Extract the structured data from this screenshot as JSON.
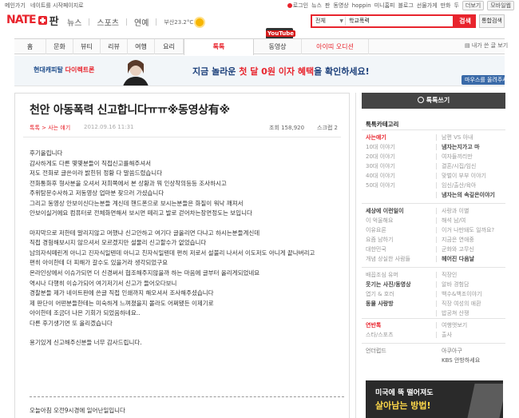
{
  "top_strip": {
    "left_links": [
      "메인가기",
      "네이트를 시작페이지로"
    ],
    "login_label": "로그인",
    "right_links": [
      "뉴스",
      "판",
      "동영상",
      "hoppin",
      "미니홈피",
      "블로그",
      "선물가게",
      "만화",
      "두",
      "더보기"
    ],
    "mobile_label": "모바일웹"
  },
  "header": {
    "logo_text": "NATE",
    "logo_sub": "판",
    "nav": [
      "뉴스",
      "스포츠",
      "연예"
    ],
    "weather": "부산23.2°C",
    "search_scope": "전체",
    "search_query": "학교폭력",
    "search_button": "검색",
    "all_search_button": "통합검색"
  },
  "menu": {
    "items": [
      "홈",
      "문화",
      "뷰티",
      "리뷰",
      "여행",
      "요리",
      "톡톡",
      "동영상",
      "아이띠 오디션"
    ],
    "active_index": 6,
    "youtube_badge": "YouTube",
    "right_link": "내가 쓴 글 보기"
  },
  "banner": {
    "brand": "현대캐피탈",
    "brand_sub": "다이렉트론",
    "text_pre": "지금 놀라운 ",
    "text_hl": "첫 달 0원 이자 혜택",
    "text_post": "을 확인하세요!",
    "more_label": "마우스를 올려주세요"
  },
  "article": {
    "title": "천안 아동폭력 신고합니다ㅠㅠ※동영상有※",
    "category": "톡톡 > 사는 얘기",
    "date": "2012.09.16 11:31",
    "views": "조회 158,920",
    "scrap": "스크랩 2",
    "paragraphs": [
      [
        "후기올립니다",
        "감사하게도 다른 몇몇분들이 직접신고를해주셔서",
        "저도 전화로 글쓴이라 밝힌뒤 정황 다 말씀드렸습니다",
        "전화통화후 형사분을 오셔서 저희쪽에서 본 상황과 뭐 인상착의등등 조사하시고",
        "주위탐문수사하고 저동영상 업마분 찾으러 가셨습니다",
        "그리고 동영상 안보이신다는분들 계신데 핸드폰으로 보시는분들은 화질이 워낙 깨져서",
        "안보이실거에요 컴퓨터로 전체화면해서 보시면 떼리고 발로 걷어차는장면정도는 보입니다"
      ],
      [
        "마지막으로 저한테 말리지않고 머했냐 신고안하고 여기다 글올리면 다냐고 하시는분들계신데",
        "직접 경험해보시지 않으셔서 모르겠지만 설물리 신고할수가 없었습니다",
        "남의자식떼린게 아니고 진자식일텐데 아니고 친자식일텐데 편히 저로서 설불리 나서서 이도저도 아니게 끝나버리고",
        "편히 아이한테 더 피해가 갈수도 있을거라 생각되었구요",
        "온라인상에서 이슈가되면 더 신경써서 협조해주지않을까 하는 마음에 글부터 올리게되었네요",
        "역시나 다행히 이슈가되어 여기저기서 신고가 들어오다보니",
        "경찰분들 제가 네이트판에 쓴글 직접 인쇄까지 해오셔서 조사해주셨습니다",
        "제 판단이 어떤분들한테는 미숙하게 느껴졌을지 몰라도 어쩌됐든 이제기로",
        "아이한테 조금더 나은 기회가 되었음하네요..",
        "다른 후기생기면 또 올리겠습니다"
      ],
      [
        "용기있게 신고해주신분들 너무 감사드립니다."
      ]
    ],
    "last_line": "오늘아침 오전9시경에 일어난일입니다"
  },
  "sidebar": {
    "write_button": "톡톡쓰기",
    "category_heading": "톡톡카테고리",
    "groups": [
      [
        [
          "사는얘기",
          "남편 VS 아내"
        ],
        [
          "10대 이야기",
          "냄자는지가고 마"
        ],
        [
          "20대 이야기",
          "여자들끼리만"
        ],
        [
          "30대 이야기",
          "결혼/시집/임신"
        ],
        [
          "40대 이야기",
          "맞벌이 부부 이야기"
        ],
        [
          "50대 이야기",
          "임신/출산/육아"
        ],
        [
          "",
          "냄자는의 속깊은이야기"
        ]
      ],
      [
        [
          "세상에 이런일이",
          "사랑과 이별"
        ],
        [
          "이 억울해요",
          "해석 남/여"
        ],
        [
          "이유요론",
          "이거 나만돼도 일까요?"
        ],
        [
          "요즘 남하기",
          "지금은 연애중"
        ],
        [
          "대한민국",
          "군화와 고무신"
        ],
        [
          "개념 상실한 사람들",
          "헤어진 다음날"
        ]
      ],
      [
        [
          "배꼽조심 유머",
          "직장인"
        ],
        [
          "웃기는 사진/동영상",
          "알바 경험담"
        ],
        [
          "엽기 & 호러",
          "백수&백조이야기"
        ],
        [
          "동물 사랑방",
          "직장 여성의 애환"
        ],
        [
          "",
          "밥공쳐 산쟁"
        ]
      ],
      [
        [
          "연반톡",
          "여행앳보기"
        ],
        [
          "스타/스포츠",
          "출사"
        ]
      ]
    ],
    "brand_row": [
      "언더럽드",
      "아쿠아구",
      "KBS 안방하세요"
    ],
    "ad_line1": "미국에 뚝 떨어져도",
    "ad_line2": "살아남는 방법!"
  }
}
